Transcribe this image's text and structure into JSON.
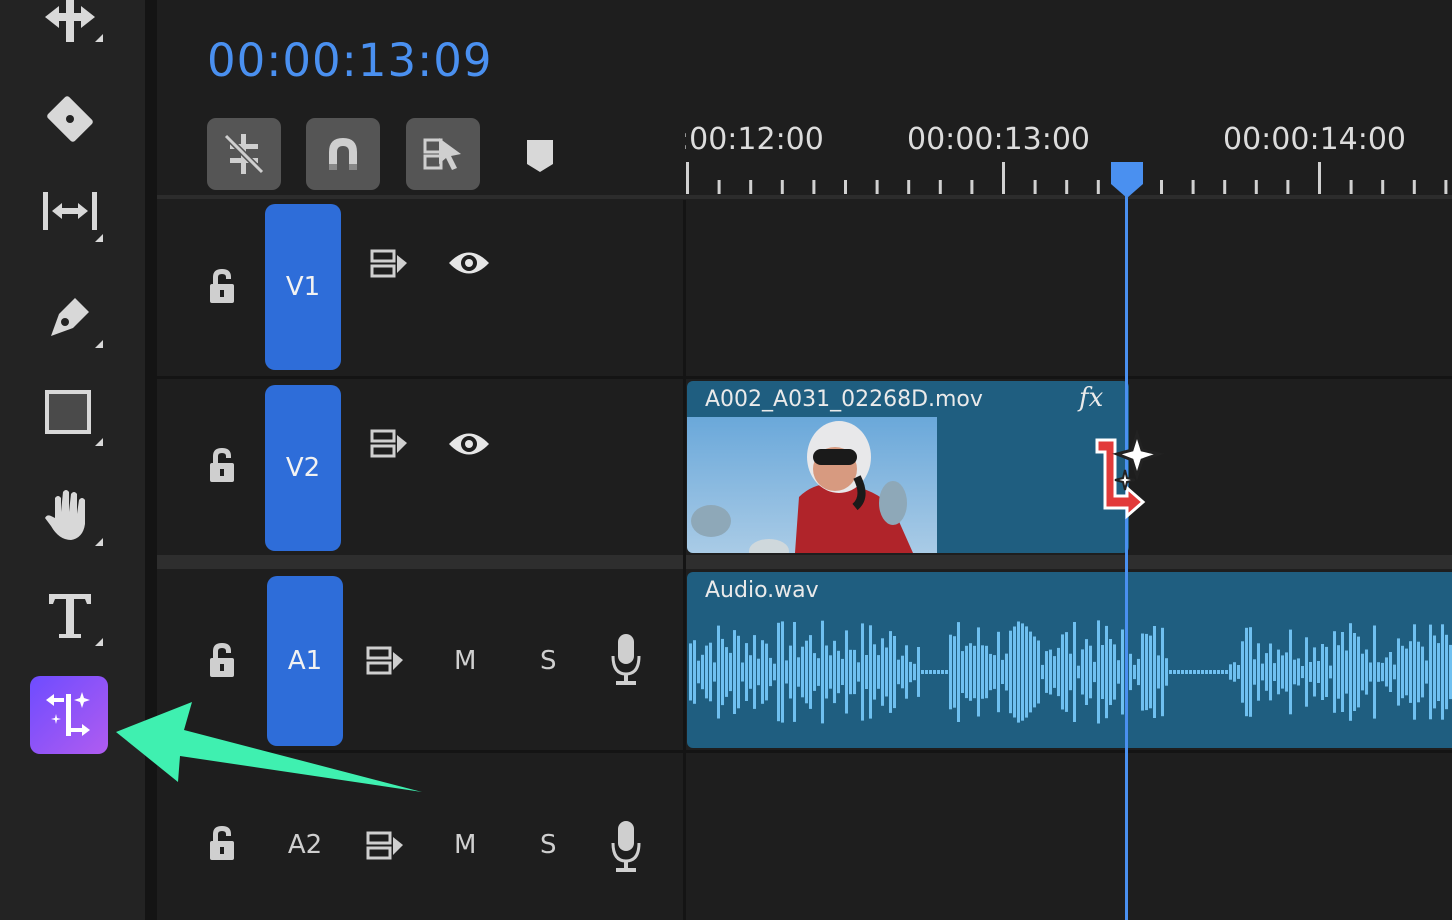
{
  "timeline": {
    "timecode": "00:00:13:09",
    "ruler_labels": [
      ":00:12:00",
      "00:00:13:00",
      "00:00:14:00"
    ],
    "tracks": [
      {
        "label": "V1",
        "kind": "video"
      },
      {
        "label": "V2",
        "kind": "video"
      },
      {
        "label": "A1",
        "kind": "audio"
      },
      {
        "label": "A2",
        "kind": "audio"
      }
    ],
    "mute_label": "M",
    "solo_label": "S",
    "video_clip": {
      "name": "A002_A031_02268D.mov",
      "fx_label": "fx"
    },
    "audio_clip": {
      "name": "Audio.wav"
    }
  },
  "colors": {
    "accent": "#4a90f0",
    "track_label_active": "#2e6dd9",
    "clip": "#1f5e80",
    "waveform": "#6fc0f0",
    "ai_tool": "#8e4dff",
    "annotation_arrow": "#3ff0b0",
    "ai_cursor": "#e23a3a"
  },
  "tools": [
    "ripple-trim-icon",
    "razor-icon",
    "slip-icon",
    "pen-icon",
    "rectangle-icon",
    "hand-icon",
    "type-icon",
    "generative-extend-icon"
  ]
}
